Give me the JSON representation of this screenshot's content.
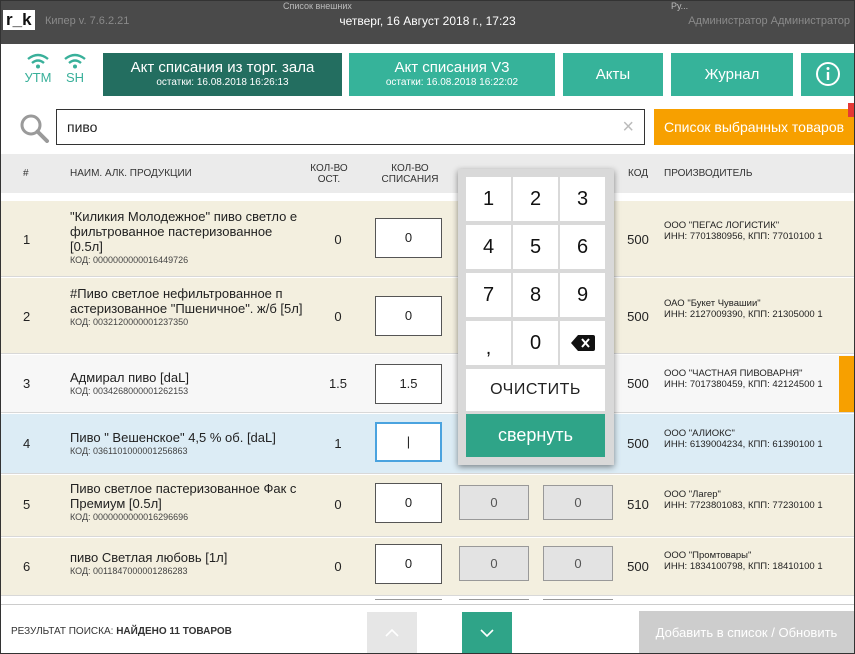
{
  "titlebar": {
    "logo": "r_k",
    "version": "Кипер v. 7.6.2.21",
    "datetime": "четверг, 16 Август 2018 г., 17:23",
    "user": "Администратор Администратор",
    "hint_left": "Список внешних",
    "hint_right": "Ру..."
  },
  "status": {
    "utm": "УТМ",
    "sh": "SH",
    "accent": "#39b09a"
  },
  "toolbar": {
    "act_hall_title": "Акт списания из торг. зала",
    "act_hall_sub": "остатки: 16.08.2018 16:26:13",
    "act_v3_title": "Акт списания V3",
    "act_v3_sub": "остатки: 16.08.2018 16:22:02",
    "acts": "Акты",
    "journal": "Журнал",
    "info_icon": "info-icon"
  },
  "search": {
    "value": "пиво",
    "clear": "×",
    "selected_list_label": "Список выбранных товаров"
  },
  "table": {
    "headers": {
      "num": "#",
      "name": "НАИМ. АЛК. ПРОДУКЦИИ",
      "rem1": "КОЛ-ВО",
      "rem2": "ОСТ.",
      "wr1": "КОЛ-ВО",
      "wr2": "СПИСАНИЯ",
      "code": "КОД",
      "producer": "ПРОИЗВОДИТЕЛЬ"
    },
    "rows": [
      {
        "num": "1",
        "name": "\"Киликия Молодежное\" пиво светло е фильтрованное пастеризованное [0.5л]",
        "code": "КОД: 0000000000016449726",
        "remaining": "0",
        "qty": "0",
        "type": "500",
        "mfr": "ООО \"ПЕГАС ЛОГИСТИК\"",
        "inn": "ИНН: 7701380956, КПП: 77010100 1"
      },
      {
        "num": "2",
        "name": "#Пиво светлое нефильтрованное п астеризованное \"Пшеничное\". ж/б [5л]",
        "code": "КОД: 0032120000001237350",
        "remaining": "0",
        "qty": "0",
        "type": "500",
        "mfr": "ОАО \"Букет Чувашии\"",
        "inn": "ИНН: 2127009390, КПП: 21305000 1"
      },
      {
        "num": "3",
        "name": "Адмирал пиво [daL]",
        "code": "КОД: 0034268000001262153",
        "remaining": "1.5",
        "qty": "1.5",
        "type": "500",
        "mfr": "ООО \"ЧАСТНАЯ ПИВОВАРНЯ\"",
        "inn": "ИНН: 7017380459, КПП: 42124500 1"
      },
      {
        "num": "4",
        "name": "Пиво \" Вешенское\" 4,5 % об. [daL]",
        "code": "КОД: 0361101000001256863",
        "remaining": "1",
        "qty": "|",
        "type": "500",
        "mfr": "ООО \"АЛИОКС\"",
        "inn": "ИНН: 6139004234, КПП: 61390100 1"
      },
      {
        "num": "5",
        "name": "Пиво светлое пастеризованное Фак с Премиум [0.5л]",
        "code": "КОД: 0000000000016296696",
        "remaining": "0",
        "qty": "0",
        "f1": "0",
        "f2": "0",
        "type": "510",
        "mfr": "ООО \"Лагер\"",
        "inn": "ИНН: 7723801083, КПП: 77230100 1"
      },
      {
        "num": "6",
        "name": "пиво Светлая любовь [1л]",
        "code": "КОД: 0011847000001286283",
        "remaining": "0",
        "qty": "0",
        "f1": "0",
        "f2": "0",
        "type": "500",
        "mfr": "ООО \"Промтовары\"",
        "inn": "ИНН: 1834100798, КПП: 18410100 1"
      }
    ]
  },
  "keypad": {
    "keys": [
      "1",
      "2",
      "3",
      "4",
      "5",
      "6",
      "7",
      "8",
      "9",
      ",",
      "0"
    ],
    "backspace_icon": "backspace-icon",
    "clear": "ОЧИСТИТЬ",
    "collapse": "свернуть"
  },
  "footer": {
    "result_label": "РЕЗУЛЬТАТ ПОИСКА:",
    "result_value": "НАЙДЕНО 11 ТОВАРОВ",
    "up_icon": "chevron-up-icon",
    "down_icon": "chevron-down-icon",
    "add_button": "Добавить в список / Обновить"
  }
}
